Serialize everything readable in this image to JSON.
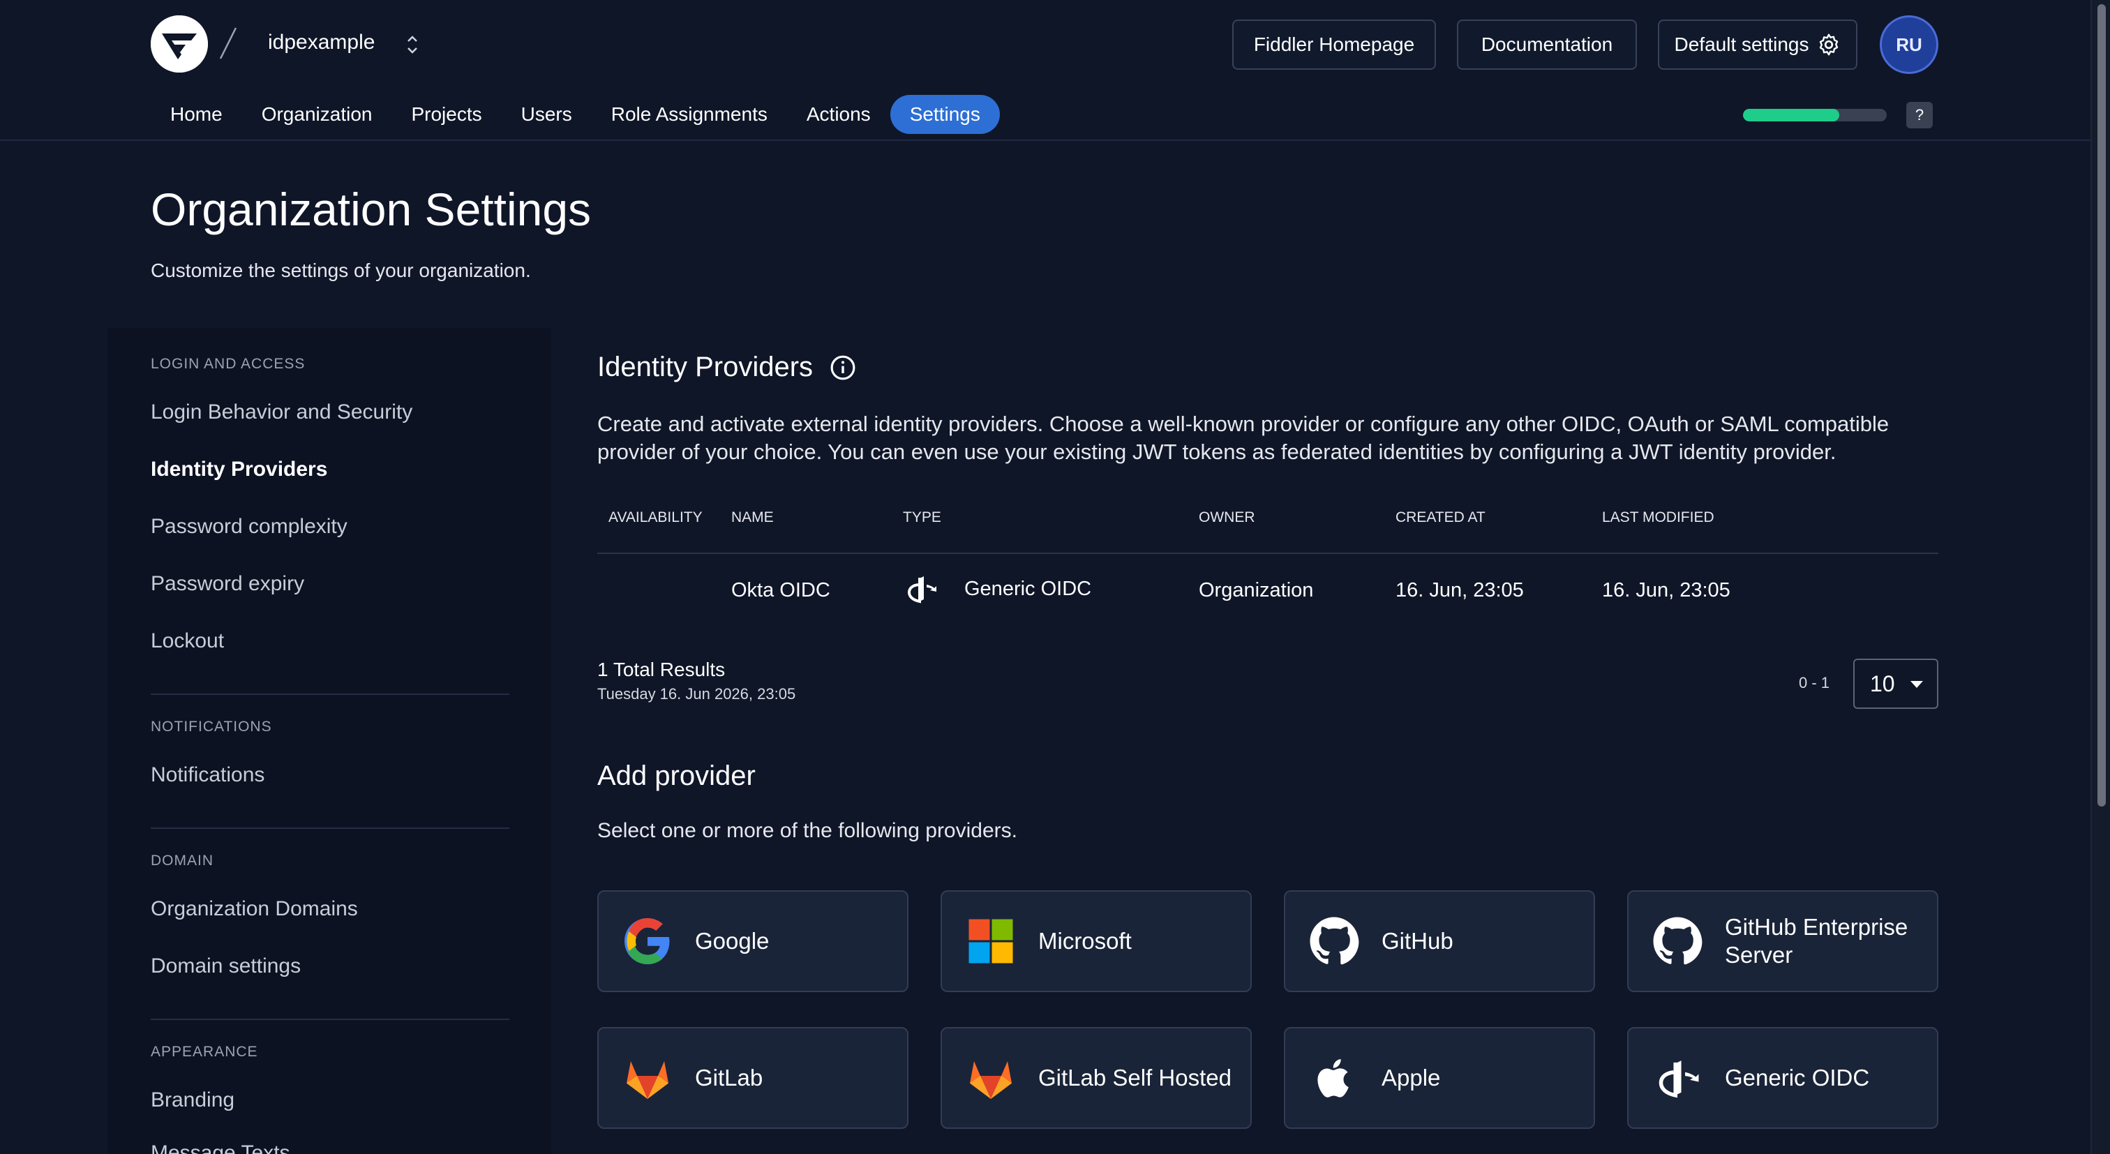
{
  "header": {
    "org_name": "idpexample",
    "buttons": {
      "homepage": "Fiddler Homepage",
      "docs": "Documentation",
      "default_settings": "Default settings"
    },
    "avatar_initials": "RU",
    "progress_fraction": 0.67,
    "help_label": "?"
  },
  "nav": {
    "items": [
      "Home",
      "Organization",
      "Projects",
      "Users",
      "Role Assignments",
      "Actions",
      "Settings"
    ],
    "active": "Settings"
  },
  "page": {
    "title": "Organization Settings",
    "subtitle": "Customize the settings of your organization."
  },
  "sidebar": {
    "sections": [
      {
        "title": "LOGIN AND ACCESS",
        "items": [
          "Login Behavior and Security",
          "Identity Providers",
          "Password complexity",
          "Password expiry",
          "Lockout"
        ]
      },
      {
        "title": "NOTIFICATIONS",
        "items": [
          "Notifications"
        ]
      },
      {
        "title": "DOMAIN",
        "items": [
          "Organization Domains",
          "Domain settings"
        ]
      },
      {
        "title": "APPEARANCE",
        "items": [
          "Branding",
          "Message Texts"
        ]
      }
    ],
    "active_item": "Identity Providers"
  },
  "identity_providers": {
    "title": "Identity Providers",
    "description": "Create and activate external identity providers. Choose a well-known provider or configure any other OIDC, OAuth or SAML compatible provider of your choice. You can even use your existing JWT tokens as federated identities by configuring a JWT identity provider.",
    "columns": [
      "AVAILABILITY",
      "NAME",
      "TYPE",
      "OWNER",
      "CREATED AT",
      "LAST MODIFIED"
    ],
    "rows": [
      {
        "availability": "",
        "name": "Okta OIDC",
        "type": "Generic OIDC",
        "type_icon": "openid-icon",
        "owner": "Organization",
        "created_at": "16. Jun, 23:05",
        "last_modified": "16. Jun, 23:05"
      }
    ],
    "total_results": "1 Total Results",
    "timestamp": "Tuesday 16. Jun 2026, 23:05",
    "range": "0 - 1",
    "page_size": "10"
  },
  "add_provider": {
    "title": "Add provider",
    "subtitle": "Select one or more of the following providers.",
    "providers": [
      {
        "label": "Google",
        "icon": "google-icon"
      },
      {
        "label": "Microsoft",
        "icon": "microsoft-icon"
      },
      {
        "label": "GitHub",
        "icon": "github-icon"
      },
      {
        "label": "GitHub Enterprise Server",
        "icon": "github-icon"
      },
      {
        "label": "GitLab",
        "icon": "gitlab-icon"
      },
      {
        "label": "GitLab Self Hosted",
        "icon": "gitlab-icon"
      },
      {
        "label": "Apple",
        "icon": "apple-icon"
      },
      {
        "label": "Generic OIDC",
        "icon": "openid-icon"
      }
    ]
  },
  "colors": {
    "background": "#0f1628",
    "accent": "#2d6fd4",
    "progress": "#1ecd8a",
    "card": "#1a2438"
  }
}
